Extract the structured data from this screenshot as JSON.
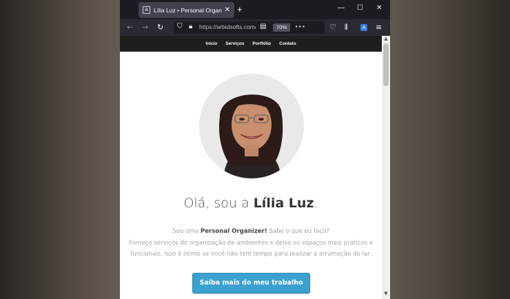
{
  "browser": {
    "tab_title": "Lília Luz • Personal Organizer",
    "url": "https://arbidsofts.com/organizer",
    "zoom": "70%"
  },
  "site": {
    "nav": [
      "Início",
      "Serviços",
      "Portfólio",
      "Contato"
    ],
    "hero_title_prefix": "Olá, sou a ",
    "hero_title_name": "Lília Luz",
    "hero_title_suffix": ".",
    "intro_prefix": "Sou uma ",
    "intro_bold": "Personal Organizer!",
    "intro_suffix": " Sabe o que eu faço?",
    "intro_body": "Forneço serviços de organização de ambientes e deixo os espaços mais práticos e funcionais. Isso é ótimo se você não tem tempo para realizar a arrumação do lar.",
    "cta_label": "Saiba mais do meu trabalho"
  },
  "colors": {
    "cta": "#3ba1cf",
    "nav_bg": "#1e1e1e",
    "browser_chrome": "#2b2a33"
  }
}
